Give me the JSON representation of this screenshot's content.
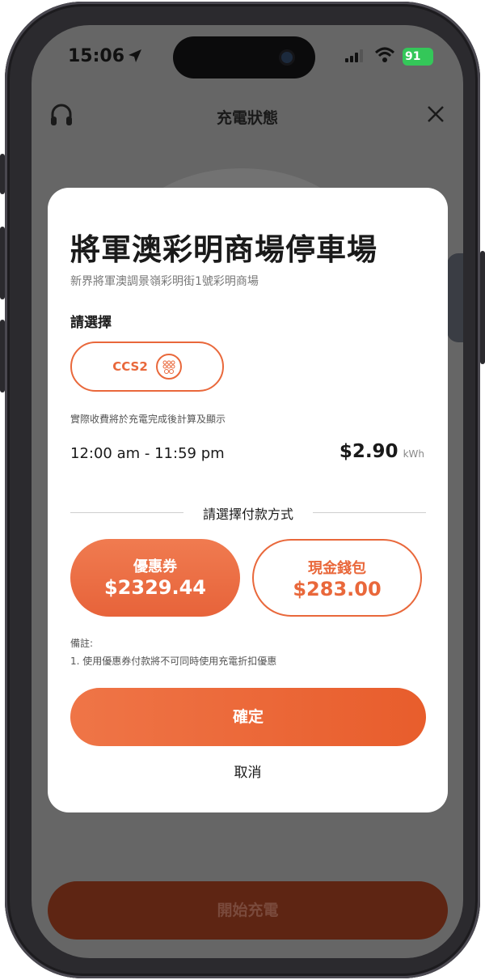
{
  "status_bar": {
    "time": "15:06",
    "battery": "91",
    "battery_color": "#34c759"
  },
  "header": {
    "title": "充電狀態",
    "left_icon": "headset-icon",
    "right_icon": "close-icon"
  },
  "modal": {
    "title": "將軍澳彩明商場停車場",
    "address": "新界將軍澳調景嶺彩明街1號彩明商場",
    "select_label": "請選擇",
    "connector": {
      "label": "CCS2",
      "icon": "ccs2-plug-icon"
    },
    "fee_note": "實際收費將於充電完成後計算及顯示",
    "tariff": {
      "time_range": "12:00 am - 11:59 pm",
      "price": "$2.90",
      "unit": "kWh"
    },
    "payment_heading": "請選擇付款方式",
    "payment_options": [
      {
        "label": "優惠券",
        "amount": "$2329.44",
        "selected": true
      },
      {
        "label": "現金錢包",
        "amount": "$283.00",
        "selected": false
      }
    ],
    "remarks_title": "備註:",
    "remarks": [
      "1. 使用優惠券付款將不可同時使用充電折扣優惠"
    ],
    "confirm_label": "確定",
    "cancel_label": "取消"
  },
  "start_button_label": "開始充電",
  "colors": {
    "accent": "#e9683b",
    "overlay": "#666666",
    "start_button": "#5e2513"
  }
}
